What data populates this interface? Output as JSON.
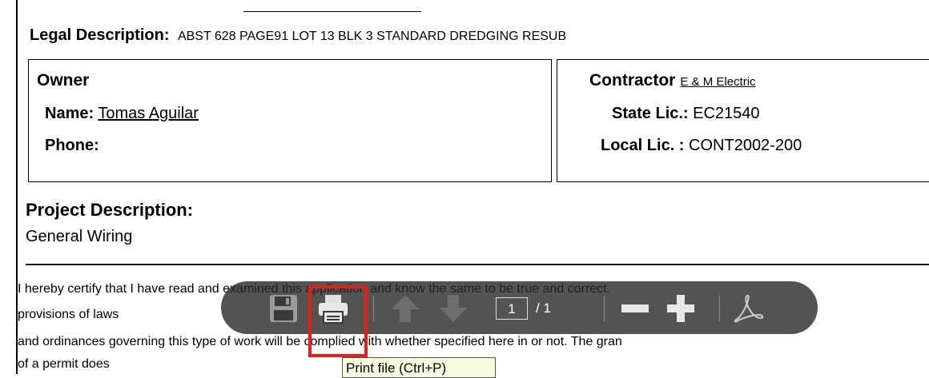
{
  "document": {
    "legal_label": "Legal Description:",
    "legal_value": "ABST 628 PAGE91 LOT 13 BLK 3 STANDARD DREDGING RESUB",
    "owner": {
      "title": "Owner",
      "name_label": "Name:",
      "name_value": "Tomas Aguilar",
      "phone_label": "Phone:"
    },
    "contractor": {
      "title": "Contractor",
      "name_value": "E & M Electric",
      "state_lic_label": "State Lic.:",
      "state_lic_value": "EC21540",
      "local_lic_label": "Local Lic. :",
      "local_lic_value": "CONT2002-200"
    },
    "project": {
      "title": "Project Description:",
      "value": "General Wiring"
    },
    "certification_lines": [
      "I hereby certify that I have read and examined this application and know the same to be true and correct.",
      "provisions of laws",
      "and ordinances governing this type of work will be complied with whether specified here in or not. The gran",
      "of a permit does"
    ]
  },
  "pdf_toolbar": {
    "current_page": "1",
    "total_pages": "/ 1",
    "icons": [
      "save-icon",
      "print-icon",
      "previous-page-icon",
      "next-page-icon",
      "zoom-out-icon",
      "zoom-in-icon",
      "acrobat-icon"
    ],
    "tooltip": "Print file (Ctrl+P)"
  },
  "colors": {
    "toolbar_bg": "#282828",
    "highlight": "#e81c1c",
    "tooltip_bg": "#fbfbe0"
  }
}
